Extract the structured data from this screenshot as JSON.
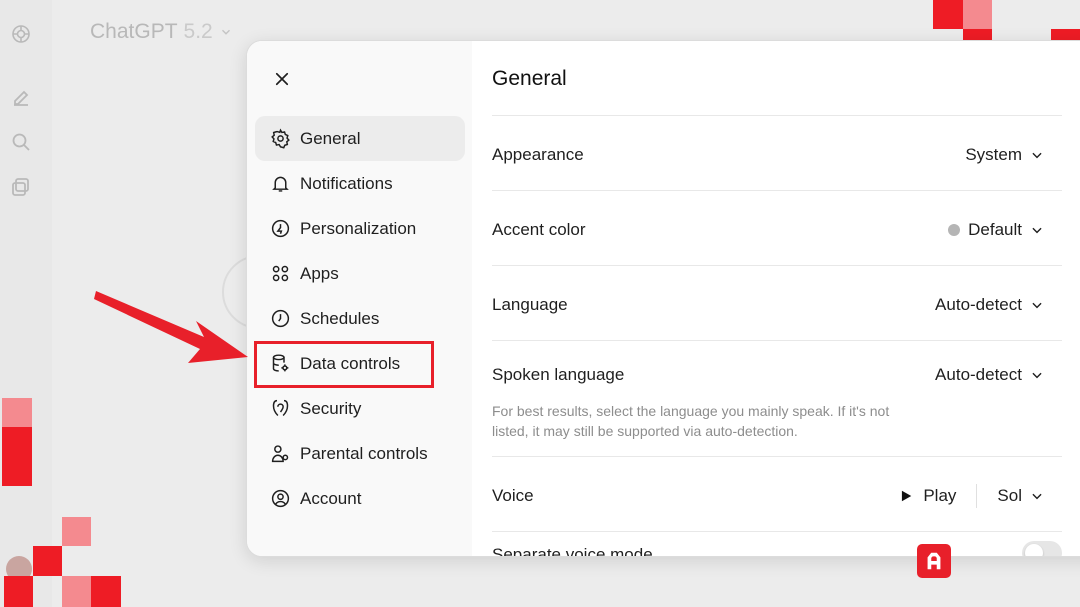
{
  "app": {
    "title": "ChatGPT",
    "version": "5.2"
  },
  "settings": {
    "close_label": "×",
    "nav": [
      {
        "label": "General",
        "icon": "gear-icon",
        "active": true
      },
      {
        "label": "Notifications",
        "icon": "bell-icon"
      },
      {
        "label": "Personalization",
        "icon": "personalization-icon"
      },
      {
        "label": "Apps",
        "icon": "apps-grid-icon"
      },
      {
        "label": "Schedules",
        "icon": "clock-icon"
      },
      {
        "label": "Data controls",
        "icon": "database-gear-icon"
      },
      {
        "label": "Security",
        "icon": "shield-icon"
      },
      {
        "label": "Parental controls",
        "icon": "parent-icon"
      },
      {
        "label": "Account",
        "icon": "account-icon"
      }
    ],
    "general": {
      "title": "General",
      "appearance": {
        "label": "Appearance",
        "value": "System"
      },
      "accent_color": {
        "label": "Accent color",
        "value": "Default",
        "swatch": "#b5b5b5"
      },
      "language": {
        "label": "Language",
        "value": "Auto-detect"
      },
      "spoken_language": {
        "label": "Spoken language",
        "value": "Auto-detect",
        "hint": "For best results, select the language you mainly speak. If it's not listed, it may still be supported via auto-detection."
      },
      "voice": {
        "label": "Voice",
        "play_label": "Play",
        "value": "Sol"
      },
      "separate_voice_mode": {
        "label": "Separate voice mode",
        "enabled": false
      }
    }
  },
  "annotation": {
    "highlight_color": "#e8202a"
  }
}
